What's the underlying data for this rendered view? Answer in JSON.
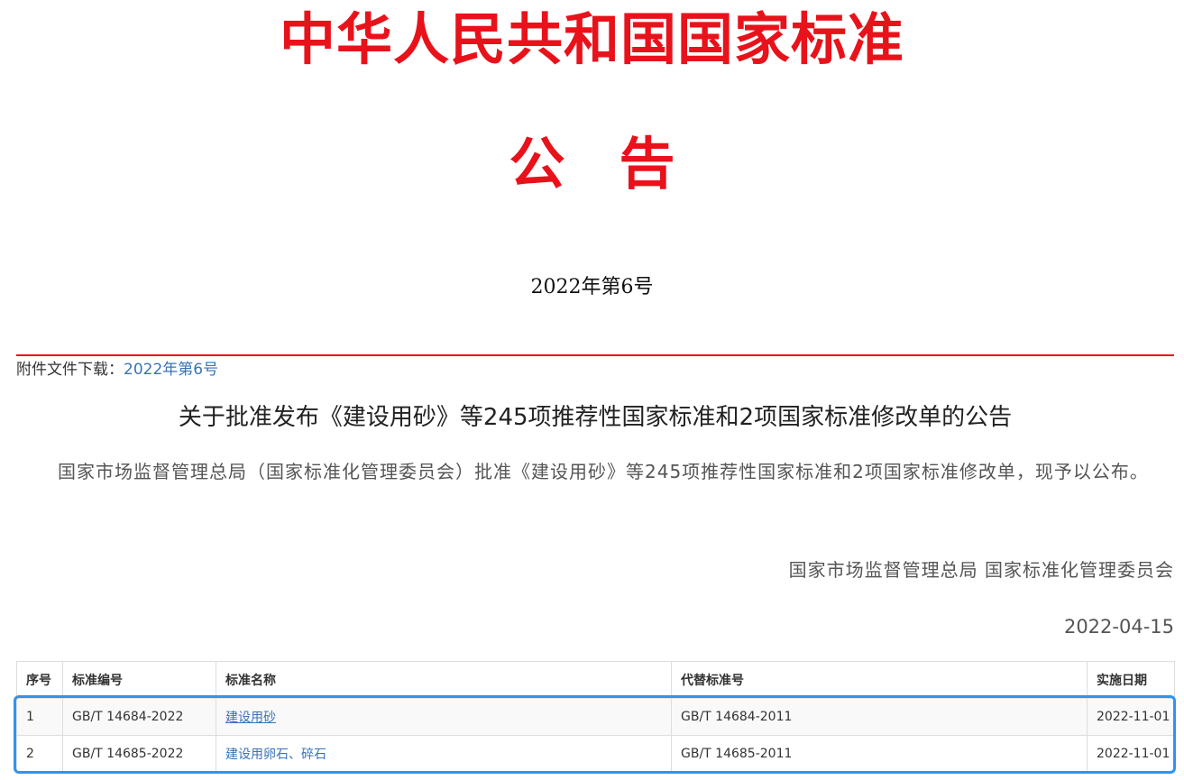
{
  "header": {
    "main_title": "中华人民共和国国家标准",
    "sub_title": "公告",
    "issue_number": "2022年第6号"
  },
  "attachment": {
    "label": "附件文件下载：",
    "link_text": "2022年第6号"
  },
  "notice": {
    "heading": "关于批准发布《建设用砂》等245项推荐性国家标准和2项国家标准修改单的公告",
    "body": "国家市场监督管理总局（国家标准化管理委员会）批准《建设用砂》等245项推荐性国家标准和2项国家标准修改单，现予以公布。",
    "signature": "国家市场监督管理总局 国家标准化管理委员会",
    "date": "2022-04-15"
  },
  "table": {
    "headers": [
      "序号",
      "标准编号",
      "标准名称",
      "代替标准号",
      "实施日期"
    ],
    "rows": [
      {
        "index": "1",
        "code": "GB/T 14684-2022",
        "name": "建设用砂",
        "replaces": "GB/T 14684-2011",
        "effective_date": "2022-11-01"
      },
      {
        "index": "2",
        "code": "GB/T 14685-2022",
        "name": "建设用卵石、碎石",
        "replaces": "GB/T 14685-2011",
        "effective_date": "2022-11-01"
      }
    ]
  },
  "colors": {
    "title_red": "#e8121b",
    "link_blue": "#3a73b5",
    "highlight_blue": "#2d95f0"
  }
}
